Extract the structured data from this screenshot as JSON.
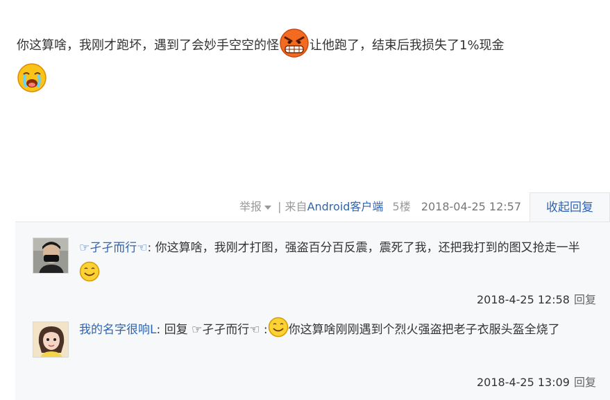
{
  "post": {
    "text_part1": "你这算啥，我刚才跑坏，遇到了会妙手空空的怪",
    "text_part2": "让他跑了，结束后我损失了1%现金",
    "emoji_1": "angry-face-icon",
    "emoji_2": "crying-face-icon"
  },
  "meta": {
    "report_label": "举报",
    "separator": " | ",
    "source_prefix": "来自",
    "source_link": "Android客户端",
    "floor": "5楼",
    "datetime": "2018-04-25 12:57",
    "collapse_label": "收起回复"
  },
  "replies": [
    {
      "username": "☞孑孑而行☜",
      "colon": ": ",
      "text": "你这算啥，我刚才打图，强盗百分百反震，震死了我，还把我打到的图又抢走一半",
      "emoji": "smile-face-icon",
      "datetime": "2018-4-25 12:58",
      "reply_label": "回复",
      "avatar": "masked-man-avatar"
    },
    {
      "username": "我的名字很响L",
      "prefix": ": 回复 ",
      "reply_to": "☞孑孑而行☜",
      "colon": " :",
      "text": "你这算啥刚刚遇到个烈火强盗把老子衣服头盔全烧了",
      "emoji": "smile-face-icon",
      "datetime": "2018-4-25 13:09",
      "reply_label": "回复",
      "avatar": "girl-avatar"
    }
  ]
}
